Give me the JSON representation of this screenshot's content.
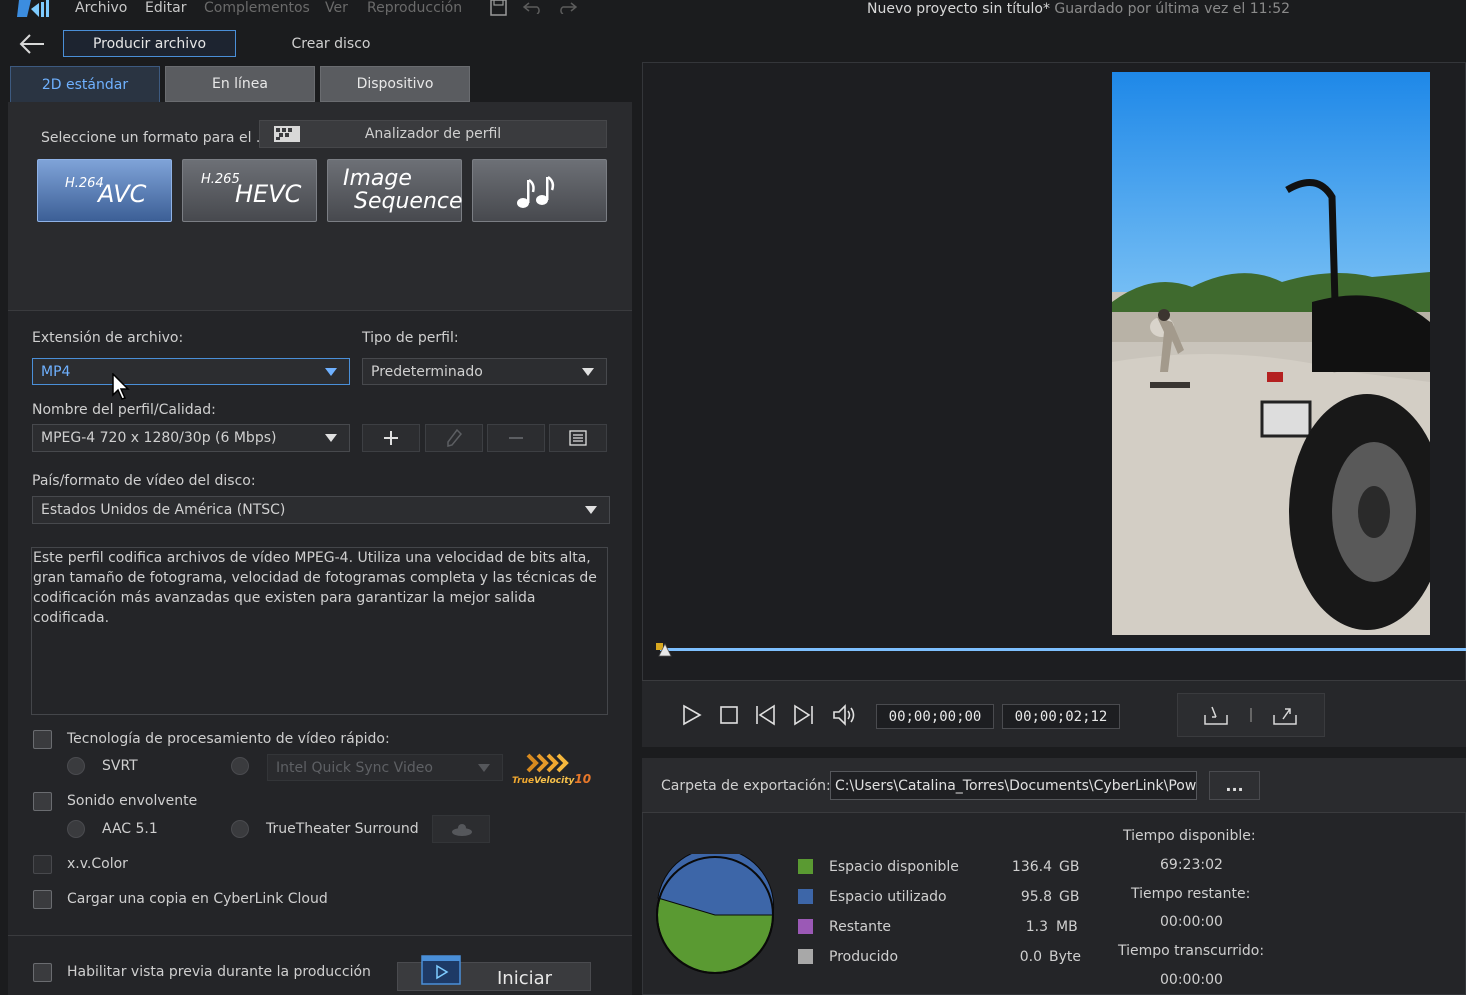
{
  "menu": {
    "archivo": "Archivo",
    "editar": "Editar",
    "complementos": "Complementos",
    "ver": "Ver",
    "reproduccion": "Reproducción"
  },
  "title": {
    "project": "Nuevo proyecto sin título*",
    "saved": "Guardado por última vez el 11:52"
  },
  "nav": {
    "produce": "Producir archivo",
    "disc": "Crear disco"
  },
  "tabs": [
    "2D estándar",
    "En línea",
    "Dispositivo"
  ],
  "format": {
    "select_label": "Seleccione un formato para el ...",
    "analyzer": "Analizador de perfil",
    "codecs": [
      {
        "small": "H.264",
        "big": "AVC"
      },
      {
        "small": "H.265",
        "big": "HEVC"
      },
      {
        "line1": "Image",
        "line2": "Sequence"
      },
      {
        "icon": "music-notes-icon"
      }
    ]
  },
  "settings": {
    "ext_label": "Extensión de archivo:",
    "ext_value": "MP4",
    "profile_type_label": "Tipo de perfil:",
    "profile_type_value": "Predeterminado",
    "profile_name_label": "Nombre del perfil/Calidad:",
    "profile_name_value": "MPEG-4 720 x 1280/30p (6 Mbps)",
    "country_label": "País/formato de vídeo del disco:",
    "country_value": "Estados Unidos de América (NTSC)",
    "description": "Este perfil codifica archivos de vídeo MPEG-4. Utiliza una velocidad de bits alta, gran tamaño de fotograma, velocidad de fotogramas completa y las técnicas de codificación más avanzadas que existen para garantizar la mejor salida codificada."
  },
  "options": {
    "fast_video": "Tecnología de procesamiento de vídeo rápido:",
    "svrt": "SVRT",
    "intel": "Intel Quick Sync Video",
    "truevelocity_a": "True",
    "truevelocity_b": "Velocity",
    "truevelocity_c": "10",
    "surround": "Sonido envolvente",
    "aac": "AAC 5.1",
    "truetheater": "TrueTheater Surround",
    "xvcolor": "x.v.Color",
    "cloud": "Cargar una copia en CyberLink Cloud",
    "preview": "Habilitar vista previa durante la producción",
    "start": "Iniciar"
  },
  "player": {
    "current_time": "00;00;00;00",
    "duration": "00;00;02;12",
    "progress": 0
  },
  "export": {
    "folder_label": "Carpeta de exportación:",
    "folder_path": "C:\\Users\\Catalina_Torres\\Documents\\CyberLink\\PowerD",
    "browse": "..."
  },
  "storage": {
    "items": [
      {
        "label": "Espacio disponible",
        "value": "136.4",
        "unit": "GB",
        "color": "#5a9a32"
      },
      {
        "label": "Espacio utilizado",
        "value": "95.8",
        "unit": "GB",
        "color": "#3d66a8"
      },
      {
        "label": "Restante",
        "value": "1.3",
        "unit": "MB",
        "color": "#9b59b6"
      },
      {
        "label": "Producido",
        "value": "0.0",
        "unit": "Byte",
        "color": "#a8a8a8"
      }
    ]
  },
  "times": {
    "available_label": "Tiempo disponible:",
    "available_value": "69:23:02",
    "remaining_label": "Tiempo restante:",
    "remaining_value": "00:00:00",
    "elapsed_label": "Tiempo transcurrido:",
    "elapsed_value": "00:00:00"
  }
}
